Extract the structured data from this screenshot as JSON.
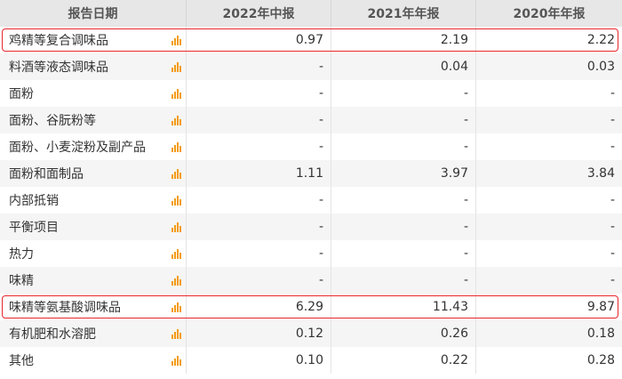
{
  "table": {
    "headers": [
      "报告日期",
      "2022年中报",
      "2021年年报",
      "2020年年报"
    ],
    "rows": [
      {
        "name": "鸡精等复合调味品",
        "values": [
          "0.97",
          "2.19",
          "2.22"
        ],
        "highlight": true
      },
      {
        "name": "料酒等液态调味品",
        "values": [
          "-",
          "0.04",
          "0.03"
        ],
        "highlight": false
      },
      {
        "name": "面粉",
        "values": [
          "-",
          "-",
          "-"
        ],
        "highlight": false
      },
      {
        "name": "面粉、谷朊粉等",
        "values": [
          "-",
          "-",
          "-"
        ],
        "highlight": false
      },
      {
        "name": "面粉、小麦淀粉及副产品",
        "values": [
          "-",
          "-",
          "-"
        ],
        "highlight": false
      },
      {
        "name": "面粉和面制品",
        "values": [
          "1.11",
          "3.97",
          "3.84"
        ],
        "highlight": false
      },
      {
        "name": "内部抵销",
        "values": [
          "-",
          "-",
          "-"
        ],
        "highlight": false
      },
      {
        "name": "平衡项目",
        "values": [
          "-",
          "-",
          "-"
        ],
        "highlight": false
      },
      {
        "name": "热力",
        "values": [
          "-",
          "-",
          "-"
        ],
        "highlight": false
      },
      {
        "name": "味精",
        "values": [
          "-",
          "-",
          "-"
        ],
        "highlight": false
      },
      {
        "name": "味精等氨基酸调味品",
        "values": [
          "6.29",
          "11.43",
          "9.87"
        ],
        "highlight": true
      },
      {
        "name": "有机肥和水溶肥",
        "values": [
          "0.12",
          "0.26",
          "0.18"
        ],
        "highlight": false
      },
      {
        "name": "其他",
        "values": [
          "0.10",
          "0.22",
          "0.28"
        ],
        "highlight": false
      }
    ]
  },
  "icons": {
    "row_chart": "bar-chart-icon"
  },
  "colors": {
    "highlight_border": "#e8262b",
    "icon_orange": "#f39c12",
    "header_bg": "#e7e7e7",
    "stripe_bg": "#f5f5f5"
  }
}
